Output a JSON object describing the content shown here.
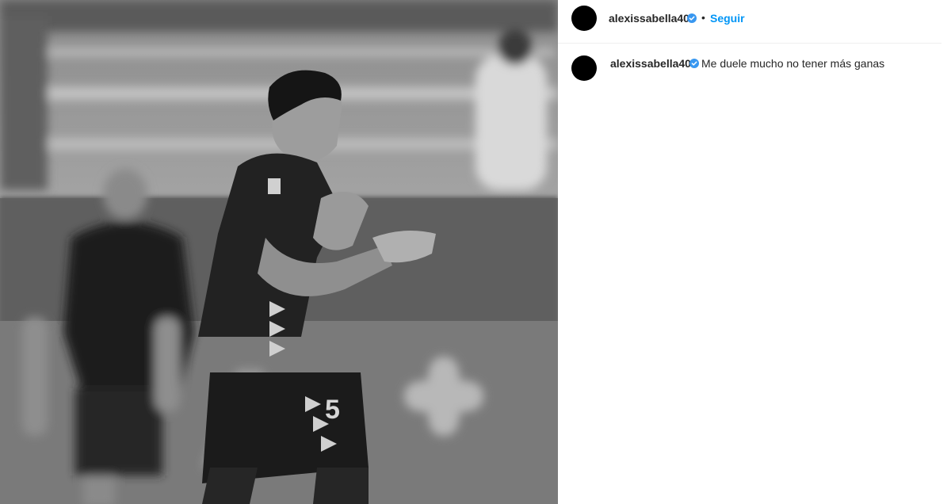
{
  "post": {
    "image_alt": "Futbolista en blanco y negro durante un partido"
  },
  "header": {
    "username": "alexissabella40",
    "separator": "•",
    "follow_label": "Seguir",
    "verified_color": "#3897f0"
  },
  "caption": {
    "username": "alexissabella40",
    "text": "Me duele mucho no tener más ganas"
  },
  "colors": {
    "follow_blue": "#0095f6",
    "verified_blue": "#3897f0",
    "text": "#262626"
  }
}
